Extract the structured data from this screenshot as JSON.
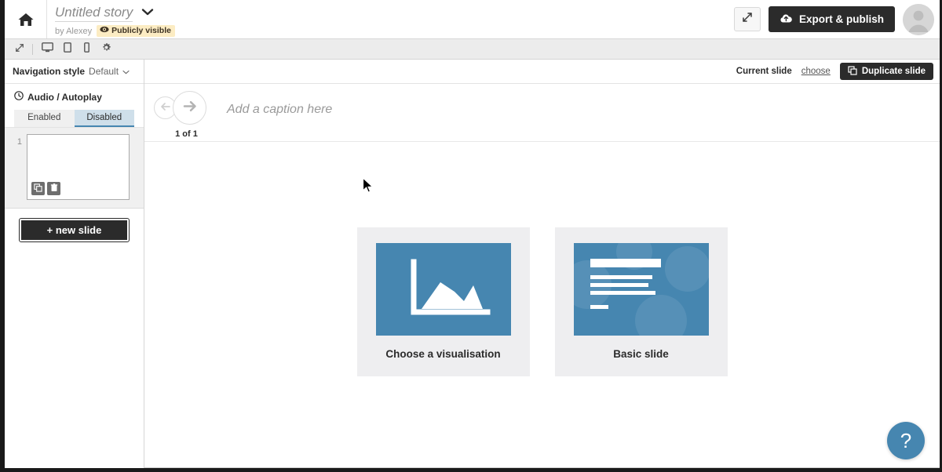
{
  "header": {
    "home_icon": "home-icon",
    "story_title": "Untitled story",
    "title_chevron": "chevron-down-icon",
    "by_line": "by Alexey",
    "visibility_badge": "Publicly visible",
    "visibility_icon": "eye-icon",
    "expand_icon": "expand-arrows-icon",
    "export_label": "Export & publish",
    "export_icon": "cloud-upload-icon",
    "avatar": "user-avatar"
  },
  "toolbar": {
    "resize_icon": "expand-arrows-icon",
    "devices": [
      {
        "name": "desktop-icon"
      },
      {
        "name": "tablet-icon"
      },
      {
        "name": "mobile-icon"
      }
    ],
    "settings_icon": "gear-icon"
  },
  "sidebar": {
    "nav_style_label": "Navigation style",
    "nav_style_value": "Default",
    "nav_style_chevron": "chevron-down-icon",
    "audio_icon": "clock-icon",
    "audio_label": "Audio / Autoplay",
    "segments": [
      {
        "label": "Enabled",
        "active": false
      },
      {
        "label": "Disabled",
        "active": true
      }
    ],
    "slides": [
      {
        "number": "1",
        "duplicate_icon": "copy-icon",
        "delete_icon": "trash-icon"
      }
    ],
    "new_slide_label": "+ new slide"
  },
  "main": {
    "current_slide_label": "Current slide",
    "choose_link": "choose",
    "duplicate_label": "Duplicate slide",
    "duplicate_icon": "copy-icon",
    "prev_icon": "arrow-left-icon",
    "next_icon": "arrow-right-icon",
    "counter": "1 of 1",
    "caption_placeholder": "Add a caption here",
    "cards": [
      {
        "label": "Choose a visualisation",
        "art": "area-chart-icon"
      },
      {
        "label": "Basic slide",
        "art": "text-slide-icon"
      }
    ],
    "help_label": "?"
  },
  "colors": {
    "accent_blue": "#4686b0",
    "dark_button": "#2b2b2b",
    "badge_yellow": "#fcecc3",
    "segment_active": "#cfdfea",
    "card_bg": "#eeeef0"
  }
}
